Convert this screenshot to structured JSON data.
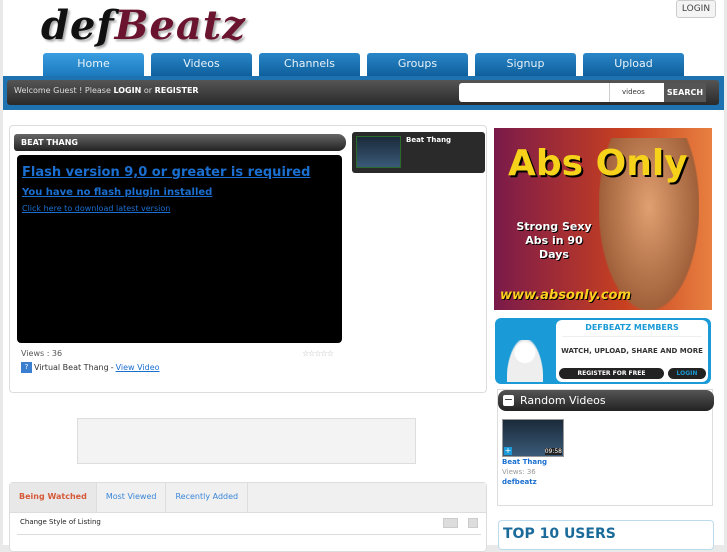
{
  "header": {
    "logo_a": "def",
    "logo_b": "Beatz",
    "login": "LOGIN"
  },
  "nav": [
    "Home",
    "Videos",
    "Channels",
    "Groups",
    "Signup",
    "Upload"
  ],
  "bar": {
    "welcome": "Welcome Guest ! Please",
    "login": "LOGIN",
    "or": "or",
    "register": "REGISTER",
    "search_scope": "videos",
    "search_button": "SEARCH"
  },
  "featured": {
    "title": "BEAT THANG",
    "flash_required": "Flash version 9,0 or greater is required",
    "no_plugin": "You have no flash plugin installed",
    "download": "Click here to download latest version",
    "views": "Views : 36",
    "stars": "☆☆☆☆☆",
    "video_name": "Virtual Beat Thang",
    "sep": "-",
    "view_video": "View Video",
    "side_title": "Beat Thang"
  },
  "tabs": {
    "items": [
      "Being Watched",
      "Most Viewed",
      "Recently Added"
    ],
    "change_style": "Change Style of Listing"
  },
  "ad": {
    "title": "Abs Only",
    "line": "Strong Sexy Abs in 90 Days",
    "url": "www.absonly.com"
  },
  "members": {
    "title": "DEFBEATZ MEMBERS",
    "subtitle": "WATCH, UPLOAD, SHARE AND MORE",
    "register": "REGISTER FOR FREE",
    "login": "LOGIN"
  },
  "random": {
    "title": "Random Videos",
    "collapse": "−",
    "video": {
      "title": "Beat Thang",
      "duration": "09:58",
      "views": "Views: 36",
      "user": "defbeatz"
    }
  },
  "top_users": {
    "title": "TOP 10 USERS"
  }
}
